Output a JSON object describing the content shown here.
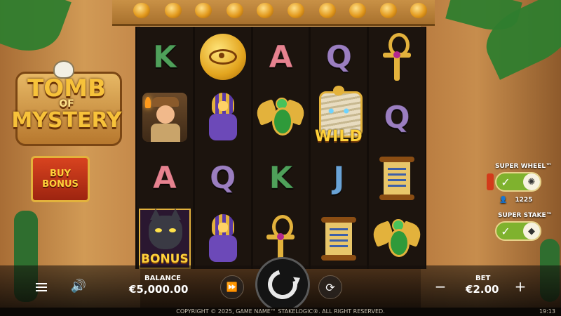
{
  "logo": {
    "line1": "TOMB",
    "line2": "OF",
    "line3": "MYSTERY"
  },
  "buy_bonus": {
    "line1": "BUY",
    "line2": "BONUS"
  },
  "reels": [
    [
      "K",
      "Explorer",
      "A",
      "Bonus"
    ],
    [
      "Eye Coin",
      "Pharaoh",
      "Q",
      "Pharaoh"
    ],
    [
      "A",
      "Scarab",
      "K",
      "Ankh"
    ],
    [
      "Q",
      "Wild",
      "J",
      "Scroll"
    ],
    [
      "Ankh",
      "Q",
      "Scroll",
      "Scarab"
    ]
  ],
  "symbol_text": {
    "wild": "WILD",
    "bonus": "BONUS"
  },
  "features": {
    "super_wheel": {
      "label": "SUPER WHEEL™",
      "enabled": true,
      "icon": "wheel-icon",
      "count": "1225"
    },
    "super_stake": {
      "label": "SUPER STAKE™",
      "enabled": true,
      "icon": "diamond-icon"
    }
  },
  "bottom": {
    "balance_label": "BALANCE",
    "balance_value": "€5,000.00",
    "bet_label": "BET",
    "bet_value": "€2.00"
  },
  "footer": {
    "copyright": "COPYRIGHT © 2025, GAME NAME™ STAKELOGIC®. ALL RIGHT RESERVED.",
    "clock": "19:13"
  },
  "colors": {
    "accent_gold": "#e3b23c",
    "toggle_green": "#7fb22e",
    "buy_red": "#d8431f"
  }
}
